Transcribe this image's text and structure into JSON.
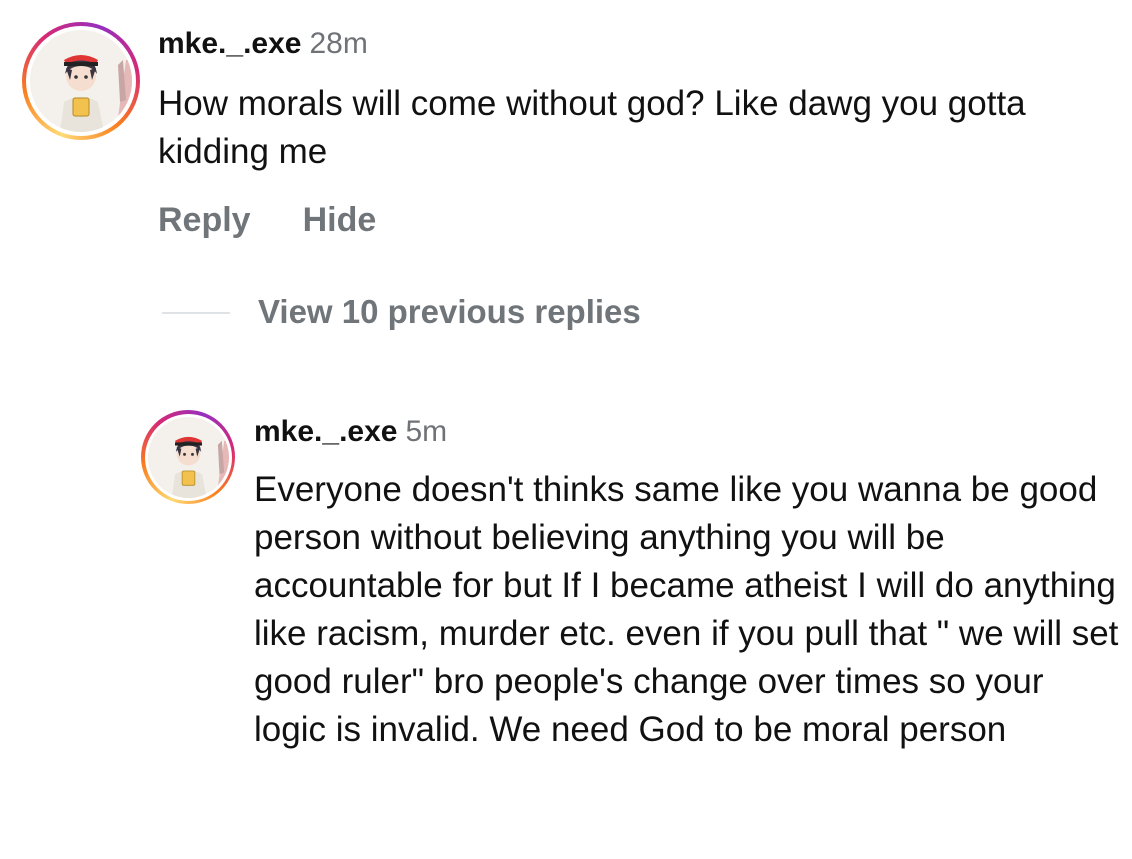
{
  "comments": [
    {
      "username": "mke._.exe",
      "time": "28m",
      "text": "How morals will come without god? Like dawg you gotta kidding me",
      "avatar_icon": "anime-character-avatar-icon"
    },
    {
      "username": "mke._.exe",
      "time": "5m",
      "text": "Everyone doesn't thinks same like you wanna be good person without believing anything you will be accountable for but If I became atheist I will do anything like racism, murder etc. even if you pull that \" we will set good ruler\" bro people's change over times so your logic is invalid. We need God to be moral person",
      "avatar_icon": "anime-character-avatar-icon"
    }
  ],
  "actions": {
    "reply_label": "Reply",
    "hide_label": "Hide"
  },
  "thread": {
    "view_replies_label": "View 10 previous replies"
  },
  "colors": {
    "primary_text": "#111111",
    "secondary_text": "#70757a",
    "story_ring": [
      "#feda75",
      "#fa7e1e",
      "#d62976",
      "#962fbf"
    ]
  }
}
